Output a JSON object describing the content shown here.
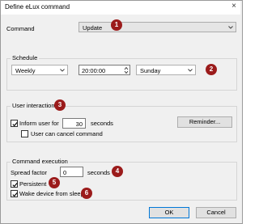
{
  "window": {
    "title": "Define eLux command",
    "close_glyph": "×"
  },
  "command": {
    "label": "Command",
    "value": "Update"
  },
  "schedule": {
    "group_title": "Schedule",
    "frequency": "Weekly",
    "time": "20:00:00",
    "day": "Sunday"
  },
  "user_interaction": {
    "group_title": "User interaction",
    "inform_label": "Inform user for",
    "inform_checked": true,
    "seconds_value": "30",
    "seconds_label": "seconds",
    "cancel_label": "User can cancel command",
    "cancel_checked": false,
    "reminder_button": "Reminder..."
  },
  "command_execution": {
    "group_title": "Command execution",
    "spread_label": "Spread factor",
    "spread_value": "0",
    "spread_unit": "seconds",
    "persistent_label": "Persistent",
    "persistent_checked": true,
    "wake_label": "Wake device from sleep",
    "wake_checked": true
  },
  "buttons": {
    "ok": "OK",
    "cancel": "Cancel"
  },
  "badges": [
    "1",
    "2",
    "3",
    "4",
    "5",
    "6"
  ],
  "colors": {
    "badge": "#9b1b1b",
    "focus_border": "#0078d7"
  }
}
